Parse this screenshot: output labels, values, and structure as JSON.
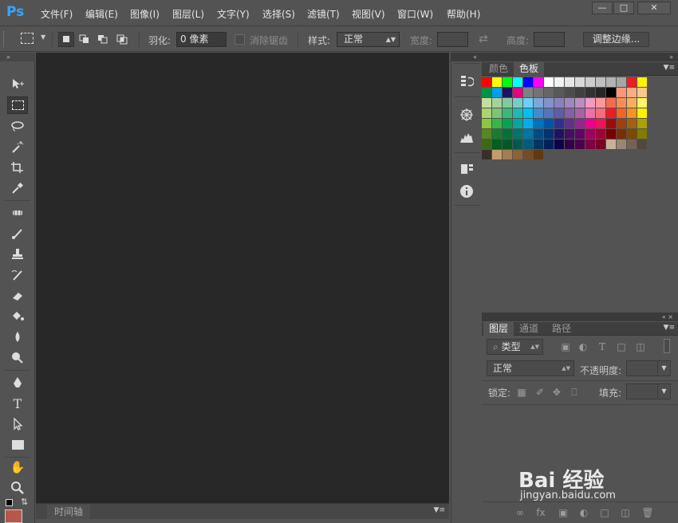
{
  "app": {
    "logo": "Ps"
  },
  "menu": [
    "文件(F)",
    "编辑(E)",
    "图像(I)",
    "图层(L)",
    "文字(Y)",
    "选择(S)",
    "滤镜(T)",
    "视图(V)",
    "窗口(W)",
    "帮助(H)"
  ],
  "options_bar": {
    "feather_label": "羽化:",
    "feather_value": "0 像素",
    "antialias_label": "消除锯齿",
    "style_label": "样式:",
    "style_value": "正常",
    "width_label": "宽度:",
    "height_label": "高度:",
    "refine_button": "调整边缘..."
  },
  "swatches_panel": {
    "tabs": [
      "颜色",
      "色板"
    ],
    "active_tab": "色板",
    "rows": [
      [
        "#ff0000",
        "#ffff00",
        "#00ff00",
        "#00ffff",
        "#0000ff",
        "#ff00ff",
        "#ffffff",
        "#f2f2f2",
        "#e6e6e6",
        "#d9d9d9",
        "#cccccc",
        "#bfbfbf",
        "#b3b3b3",
        "#a6a6a6",
        "#ed1c24",
        "#fff200"
      ],
      [
        "#009245",
        "#00a0e9",
        "#1b1464",
        "#e4007f",
        "#808080",
        "#737373",
        "#666666",
        "#595959",
        "#4d4d4d",
        "#404040",
        "#333333",
        "#262626",
        "#000000",
        "#f7977a",
        "#fbad82",
        "#fdc68a"
      ],
      [
        "#c4df9b",
        "#a3d39c",
        "#82ca9c",
        "#7accc8",
        "#6dcff6",
        "#7da7d9",
        "#8393ca",
        "#8882be",
        "#a187be",
        "#bc8dbf",
        "#f49ac2",
        "#f6989d",
        "#f26c4f",
        "#f68e56",
        "#fbaf5c",
        "#fff468"
      ],
      [
        "#acd372",
        "#7cc576",
        "#3bb878",
        "#1abbb4",
        "#00bff3",
        "#438ccb",
        "#5574b9",
        "#605ca8",
        "#855fa8",
        "#a763a8",
        "#f06eaa",
        "#f26d7d",
        "#ed1c24",
        "#f26522",
        "#f7941d",
        "#fff200"
      ],
      [
        "#8dc63f",
        "#39b54a",
        "#00a651",
        "#00a99d",
        "#00aeef",
        "#0072bc",
        "#0054a6",
        "#2e3192",
        "#662d91",
        "#92278f",
        "#ec008c",
        "#ed145b",
        "#9e0b0f",
        "#a0410d",
        "#a36209",
        "#aba000"
      ],
      [
        "#598527",
        "#197b30",
        "#007236",
        "#00746b",
        "#0076a3",
        "#004b80",
        "#003471",
        "#1b1464",
        "#440e62",
        "#630460",
        "#9e005d",
        "#9e0039",
        "#790000",
        "#7b2e00",
        "#7d4900",
        "#827b00"
      ],
      [
        "#406618",
        "#005e20",
        "#005826",
        "#005952",
        "#005b7f",
        "#003663",
        "#002157",
        "#0d004c",
        "#32004b",
        "#4b0049",
        "#7b0046",
        "#7a0026",
        "#c7b299",
        "#998675",
        "#736357",
        "#534741"
      ],
      [
        "#37302a",
        "#c69c6d",
        "#a67c52",
        "#8c6239",
        "#754c24",
        "#603913"
      ]
    ]
  },
  "layers_panel": {
    "tabs": [
      "图层",
      "通道",
      "路径"
    ],
    "active_tab": "图层",
    "filter_label": "类型",
    "blend_mode": "正常",
    "opacity_label": "不透明度:",
    "lock_label": "锁定:",
    "fill_label": "填充:"
  },
  "timeline": {
    "tab": "时间轴"
  },
  "watermark": {
    "brand": "Bai 经验",
    "url": "jingyan.baidu.com"
  },
  "colors": {
    "foreground": "#000000",
    "background": "#b5584a"
  }
}
